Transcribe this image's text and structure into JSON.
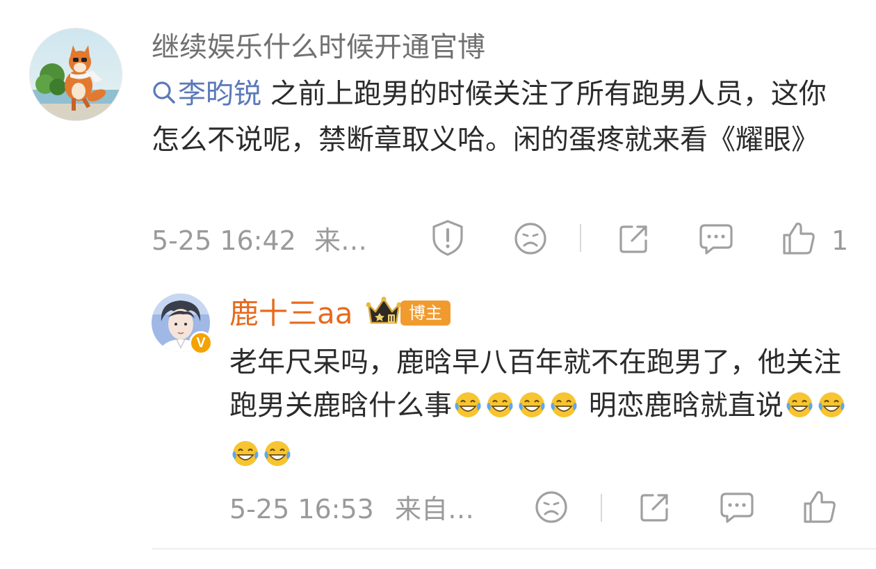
{
  "comment": {
    "username": "继续娱乐什么时候开通官博",
    "mention": "李昀锐",
    "text_part1": " 之前上跑男的时候关注了所有跑男人员，这你怎么不说呢，禁断章取义哈。闲的蛋疼就来看《耀眼》",
    "timestamp": "5-25 16:42",
    "source": "来…",
    "like_count": "1",
    "icons": {
      "report": "report-shield-icon",
      "dislike": "sad-face-icon",
      "share": "share-icon",
      "reply": "comment-bubble-icon",
      "like": "thumbs-up-icon"
    }
  },
  "reply": {
    "username": "鹿十三aa",
    "badge_label": "博主",
    "verified_mark": "V",
    "text_part1": "老年尺呆吗，鹿晗早八百年就不在跑男了，他关注跑男关鹿晗什么事",
    "text_part2": " 明恋鹿晗就直说",
    "emoji_name": "laugh-cry-emoji",
    "timestamp": "5-25 16:53",
    "source": "来自…"
  },
  "colors": {
    "username_orange": "#e86a1c",
    "mention_blue": "#5b79b9",
    "meta_gray": "#9a9a9a",
    "blogger_tag": "#f19b2f"
  }
}
